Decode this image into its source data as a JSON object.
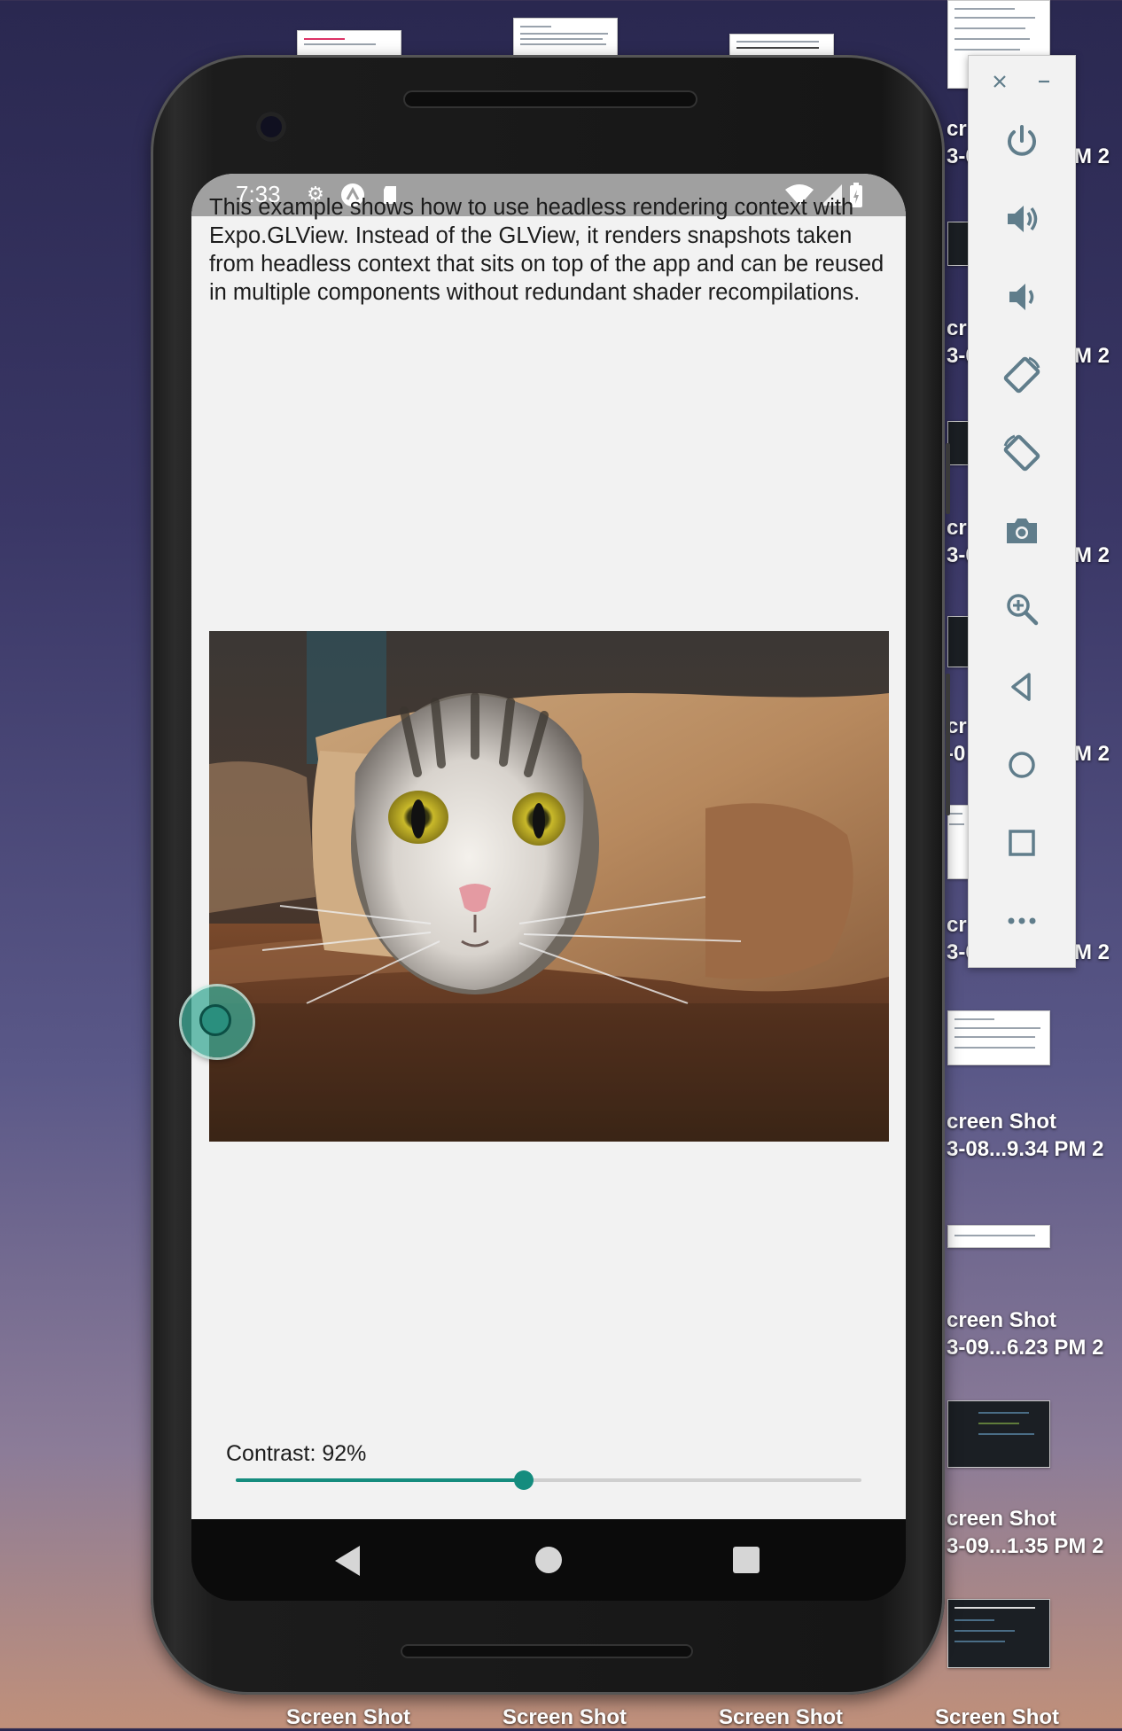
{
  "phone": {
    "status_bar": {
      "time": "7:33"
    },
    "description": "This example shows how to use headless rendering context with Expo.GLView. Instead of the GLView, it renders snapshots taken from headless context that sits on top of the app and can be reused in multiple components without redundant shader recompilations.",
    "contrast": {
      "label": "Contrast: 92%",
      "value_percent": 92,
      "slider_fraction": 0.46
    },
    "accent_color": "#158c7e"
  },
  "emulator_toolbar": {
    "buttons": [
      "close-icon",
      "minimize-icon",
      "power-icon",
      "volume-up-icon",
      "volume-down-icon",
      "rotate-left-icon",
      "rotate-right-icon",
      "camera-icon",
      "zoom-icon",
      "back-icon",
      "home-icon",
      "overview-icon",
      "more-icon"
    ]
  },
  "desktop": {
    "right_column": [
      {
        "line1": "cr",
        "line2": "3-0",
        "time_suffix": "M",
        "extra": "2"
      },
      {
        "line1": "cr",
        "line2": "3-0",
        "time_suffix": "M",
        "extra": "2"
      },
      {
        "line1": "cr",
        "line2": "3-0",
        "time_suffix": "M",
        "extra": "2"
      },
      {
        "line1": "cr",
        "line2": "-0",
        "time_suffix": "M",
        "extra": "2"
      },
      {
        "line1": "cr",
        "line2": "3-0",
        "time_suffix": "M",
        "extra": "2"
      },
      {
        "line1": "creen Shot",
        "line2": "3-08...9.34 PM",
        "extra": "2"
      },
      {
        "line1": "creen Shot",
        "line2": "3-09...6.23 PM",
        "extra": "2"
      },
      {
        "line1": "creen Shot",
        "line2": "3-09...1.35 PM",
        "extra": "2"
      }
    ],
    "bottom_row": [
      "Screen Shot",
      "Screen Shot",
      "Screen Shot",
      "Screen Shot"
    ]
  }
}
